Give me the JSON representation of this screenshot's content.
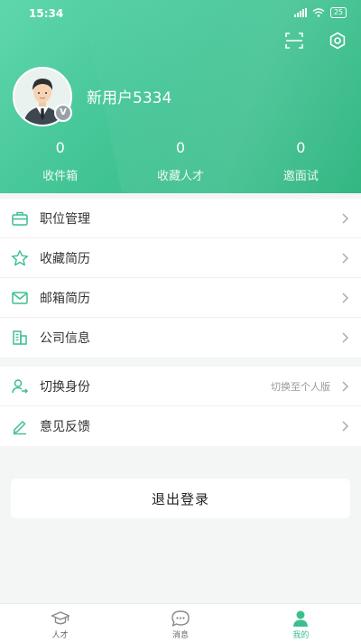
{
  "status_bar": {
    "time": "15:34",
    "battery": "25"
  },
  "header": {
    "username": "新用户5334",
    "badge": "V",
    "stats": [
      {
        "value": "0",
        "label": "收件箱"
      },
      {
        "value": "0",
        "label": "收藏人才"
      },
      {
        "value": "0",
        "label": "邀面试"
      }
    ]
  },
  "menu_group_1": [
    {
      "label": "职位管理",
      "icon": "briefcase-icon"
    },
    {
      "label": "收藏简历",
      "icon": "star-icon"
    },
    {
      "label": "邮箱简历",
      "icon": "mail-icon"
    },
    {
      "label": "公司信息",
      "icon": "building-icon"
    }
  ],
  "menu_group_2": [
    {
      "label": "切换身份",
      "extra": "切换至个人版",
      "icon": "switch-user-icon"
    },
    {
      "label": "意见反馈",
      "icon": "edit-icon"
    }
  ],
  "logout_label": "退出登录",
  "tabs": [
    {
      "label": "人才",
      "icon": "graduation-cap-icon",
      "active": false
    },
    {
      "label": "消息",
      "icon": "chat-icon",
      "active": false
    },
    {
      "label": "我的",
      "icon": "user-icon",
      "active": true
    }
  ],
  "colors": {
    "accent": "#3bbf8e",
    "header_start": "#5fd7ad",
    "header_end": "#2fb57f"
  }
}
